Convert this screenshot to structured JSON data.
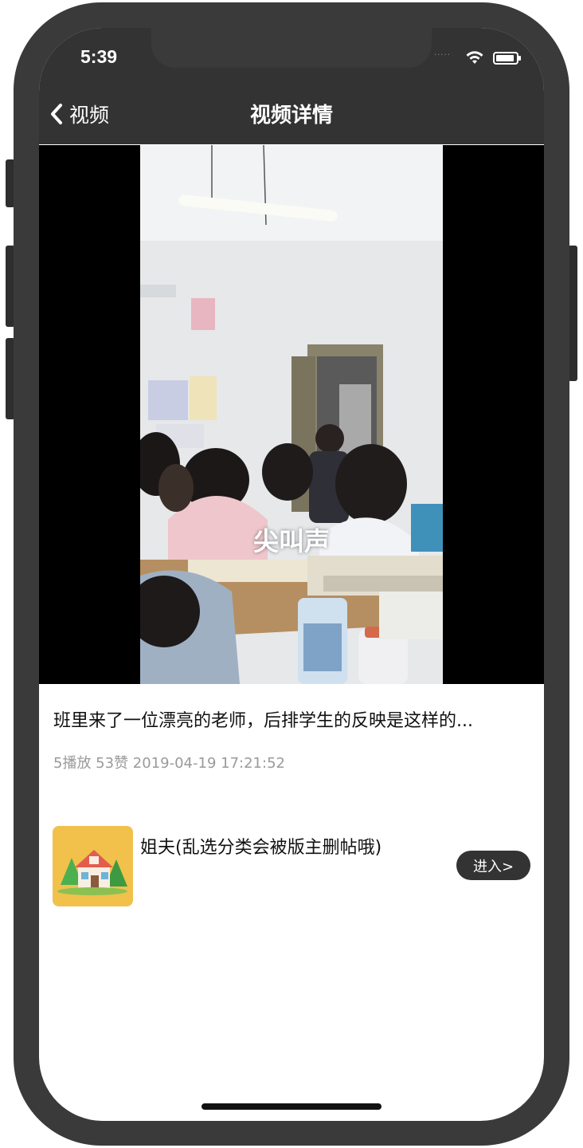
{
  "status_bar": {
    "time": "5:39",
    "signal_dots": "....."
  },
  "nav": {
    "back_label": "视频",
    "title": "视频详情"
  },
  "video": {
    "caption": "尖叫声"
  },
  "details": {
    "title": "班里来了一位漂亮的老师，后排学生的反映是这样的...",
    "meta": "5播放 53赞 2019-04-19 17:21:52"
  },
  "channel": {
    "name": "姐夫(乱选分类会被版主删帖哦)",
    "enter_label": "进入>"
  },
  "colors": {
    "nav_bg": "#333333",
    "video_bg": "#000000",
    "meta_text": "#9a9a9a",
    "avatar_bg": "#f1c14c",
    "enter_button_bg": "#333333"
  }
}
